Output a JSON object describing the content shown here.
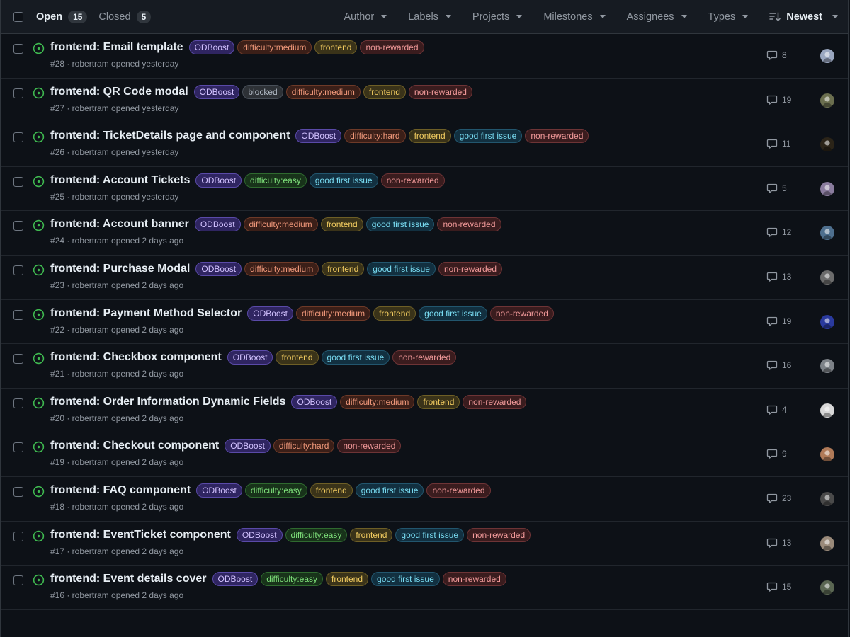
{
  "header": {
    "open_label": "Open",
    "open_count": "15",
    "closed_label": "Closed",
    "closed_count": "5",
    "filters": [
      "Author",
      "Labels",
      "Projects",
      "Milestones",
      "Assignees",
      "Types"
    ],
    "sort_label": "Newest"
  },
  "label_styles": {
    "ODBoost": {
      "fg": "#d2c2ff",
      "bg": "#2f2561",
      "border": "#5a4aa8"
    },
    "blocked": {
      "fg": "#b1bac4",
      "bg": "#2d3136",
      "border": "#484f58"
    },
    "difficulty:medium": {
      "fg": "#f0987a",
      "bg": "#3b1f18",
      "border": "#6e3a28"
    },
    "difficulty:hard": {
      "fg": "#f0987a",
      "bg": "#3b1f18",
      "border": "#6e3a28"
    },
    "difficulty:easy": {
      "fg": "#7ee07a",
      "bg": "#18331a",
      "border": "#2f6a2f"
    },
    "frontend": {
      "fg": "#f2cc60",
      "bg": "#3a3319",
      "border": "#6e5f26"
    },
    "good first issue": {
      "fg": "#79dcf2",
      "bg": "#123040",
      "border": "#22566e"
    },
    "non-rewarded": {
      "fg": "#f29a9a",
      "bg": "#3a1c1e",
      "border": "#6e3436"
    }
  },
  "issues": [
    {
      "title": "frontend: Email template",
      "labels": [
        "ODBoost",
        "difficulty:medium",
        "frontend",
        "non-rewarded"
      ],
      "meta": "#28 · robertram opened yesterday",
      "comments": "8",
      "avatar": "#9aa7c0"
    },
    {
      "title": "frontend: QR Code modal",
      "labels": [
        "ODBoost",
        "blocked",
        "difficulty:medium",
        "frontend",
        "non-rewarded"
      ],
      "meta": "#27 · robertram opened yesterday",
      "comments": "19",
      "avatar": "#6b6f4f"
    },
    {
      "title": "frontend: TicketDetails page and component",
      "labels": [
        "ODBoost",
        "difficulty:hard",
        "frontend",
        "good first issue",
        "non-rewarded"
      ],
      "meta": "#26 · robertram opened yesterday",
      "comments": "11",
      "avatar": "#2b2418"
    },
    {
      "title": "frontend: Account Tickets",
      "labels": [
        "ODBoost",
        "difficulty:easy",
        "good first issue",
        "non-rewarded"
      ],
      "meta": "#25 · robertram opened yesterday",
      "comments": "5",
      "avatar": "#8a7c9e"
    },
    {
      "title": "frontend: Account banner",
      "labels": [
        "ODBoost",
        "difficulty:medium",
        "frontend",
        "good first issue",
        "non-rewarded"
      ],
      "meta": "#24 · robertram opened 2 days ago",
      "comments": "12",
      "avatar": "#4e6f8e"
    },
    {
      "title": "frontend: Purchase Modal",
      "labels": [
        "ODBoost",
        "difficulty:medium",
        "frontend",
        "good first issue",
        "non-rewarded"
      ],
      "meta": "#23 · robertram opened 2 days ago",
      "comments": "13",
      "avatar": "#6c6c6c"
    },
    {
      "title": "frontend: Payment Method Selector",
      "labels": [
        "ODBoost",
        "difficulty:medium",
        "frontend",
        "good first issue",
        "non-rewarded"
      ],
      "meta": "#22 · robertram opened 2 days ago",
      "comments": "19",
      "avatar": "#2a3a9e"
    },
    {
      "title": "frontend: Checkbox component",
      "labels": [
        "ODBoost",
        "frontend",
        "good first issue",
        "non-rewarded"
      ],
      "meta": "#21 · robertram opened 2 days ago",
      "comments": "16",
      "avatar": "#7d8288"
    },
    {
      "title": "frontend: Order Information Dynamic Fields",
      "labels": [
        "ODBoost",
        "difficulty:medium",
        "frontend",
        "non-rewarded"
      ],
      "meta": "#20 · robertram opened 2 days ago",
      "comments": "4",
      "avatar": "#d8d8d8"
    },
    {
      "title": "frontend: Checkout component",
      "labels": [
        "ODBoost",
        "difficulty:hard",
        "non-rewarded"
      ],
      "meta": "#19 · robertram opened 2 days ago",
      "comments": "9",
      "avatar": "#b07a58"
    },
    {
      "title": "frontend: FAQ component",
      "labels": [
        "ODBoost",
        "difficulty:easy",
        "frontend",
        "good first issue",
        "non-rewarded"
      ],
      "meta": "#18 · robertram opened 2 days ago",
      "comments": "23",
      "avatar": "#4a4a4a"
    },
    {
      "title": "frontend: EventTicket component",
      "labels": [
        "ODBoost",
        "difficulty:easy",
        "frontend",
        "good first issue",
        "non-rewarded"
      ],
      "meta": "#17 · robertram opened 2 days ago",
      "comments": "13",
      "avatar": "#9a8a7a"
    },
    {
      "title": "frontend: Event details cover",
      "labels": [
        "ODBoost",
        "difficulty:easy",
        "frontend",
        "good first issue",
        "non-rewarded"
      ],
      "meta": "#16 · robertram opened 2 days ago",
      "comments": "15",
      "avatar": "#5a6652"
    }
  ]
}
